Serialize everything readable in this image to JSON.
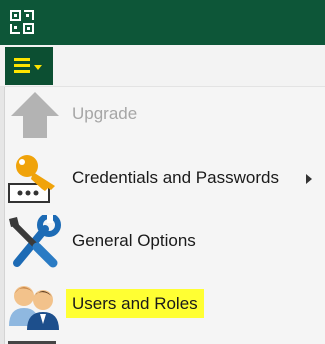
{
  "colors": {
    "titlebar": "#0d5638",
    "menu_button": "#0c4f32",
    "menu_button_icon": "#ffe500",
    "menu_background": "#f5f5f5",
    "highlight": "#ffff33",
    "disabled_text": "#a6a6a6"
  },
  "header": {
    "logo_icon": "qr-logo-icon"
  },
  "toolbar": {
    "menu_button_icon": "hamburger-menu-icon"
  },
  "menu": {
    "items": [
      {
        "label": "Upgrade",
        "icon": "up-arrow-icon",
        "disabled": true
      },
      {
        "label": "Credentials and Passwords",
        "icon": "key-icon",
        "has_submenu": true,
        "submenu_icon": "chevron-right-icon"
      },
      {
        "label": "General Options",
        "icon": "tools-icon"
      },
      {
        "label": "Users and Roles",
        "icon": "users-icon",
        "highlighted": true
      }
    ]
  }
}
